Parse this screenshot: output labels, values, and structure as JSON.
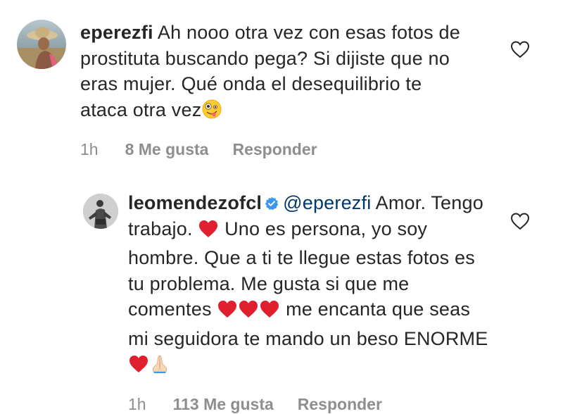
{
  "comments": [
    {
      "username": "eperezfi",
      "text": "Ah nooo otra vez con esas fotos de prostituta buscando pega? Si dijiste que no eras mujer. Qué onda el desequilibrio te ataca otra vez",
      "time": "1h",
      "likes": "8 Me gusta",
      "reply": "Responder",
      "like_icon": "heart-outline-icon"
    },
    {
      "username": "leomendezofcl",
      "verified": true,
      "mention": "@eperezfi",
      "text_1": "Amor. Tengo trabajo.",
      "text_2": "Uno es persona, yo soy hombre. Que a ti te llegue estas fotos es tu problema. Me gusta si que me comentes",
      "text_3": "me encanta que seas mi seguidora te mando un beso ENORME",
      "time": "1h",
      "likes": "113 Me gusta",
      "reply": "Responder",
      "like_icon": "heart-outline-icon"
    }
  ]
}
